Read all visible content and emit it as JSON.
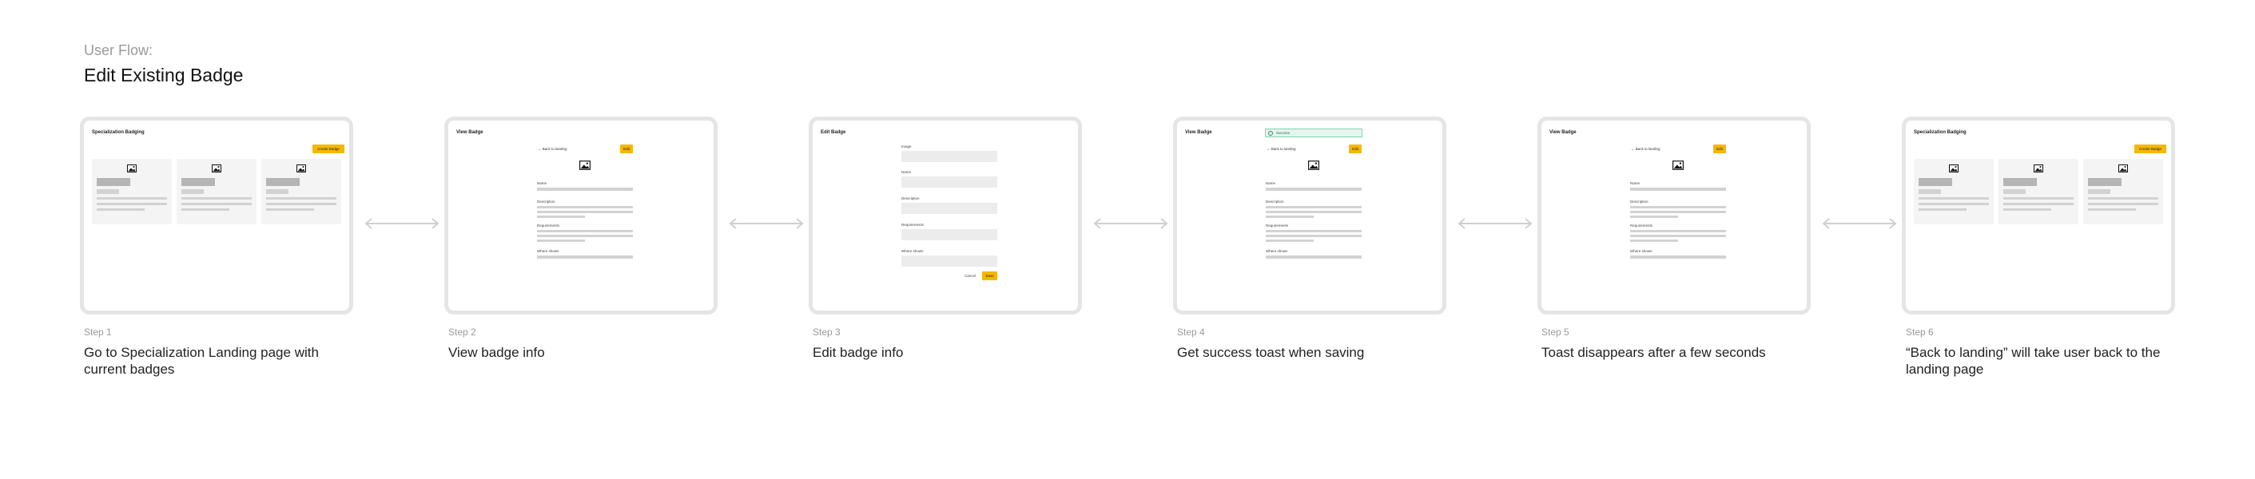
{
  "header": {
    "kicker": "User Flow:",
    "title": "Edit Existing Badge"
  },
  "ui": {
    "landing_title": "Specialization Badging",
    "create_badge": "Create Badge",
    "view_title": "View Badge",
    "edit_title": "Edit Badge",
    "back_link": "Back to landing",
    "edit_btn": "Edit",
    "name_label": "Name",
    "description_label": "Description",
    "requirements_label": "Requirements",
    "where_label": "Where shown",
    "image_label": "Image",
    "cancel": "Cancel",
    "save": "Save",
    "toast": "Success"
  },
  "steps": [
    {
      "num": "Step 1",
      "desc": "Go to Specialization Landing page with current badges"
    },
    {
      "num": "Step 2",
      "desc": "View badge info"
    },
    {
      "num": "Step 3",
      "desc": "Edit badge info"
    },
    {
      "num": "Step 4",
      "desc": "Get success toast when saving"
    },
    {
      "num": "Step 5",
      "desc": "Toast disappears after a few seconds"
    },
    {
      "num": "Step 6",
      "desc": "“Back to landing” will take user back to the landing page"
    }
  ],
  "colors": {
    "accent": "#f5b800",
    "frame_border": "#e5e5e5",
    "toast_bg": "#e3f6ee",
    "muted_text": "#9a9a9a"
  },
  "icons": {
    "image": "image-icon",
    "arrow": "double-arrow-icon",
    "back": "arrow-left-icon",
    "check": "check-circle-icon"
  }
}
